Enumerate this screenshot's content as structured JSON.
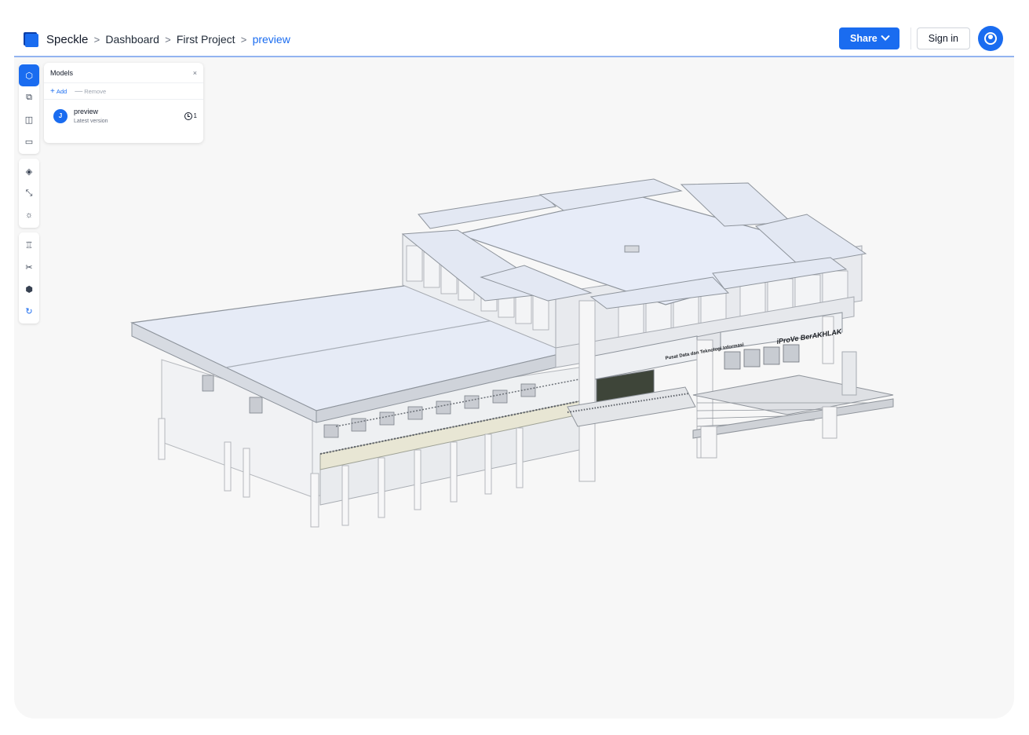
{
  "header": {
    "brand": "Speckle",
    "breadcrumbs": [
      "Dashboard",
      "First Project",
      "preview"
    ],
    "separator": ">",
    "share_label": "Share",
    "signin_label": "Sign in"
  },
  "toolbar": {
    "icons": [
      "models-cube-icon",
      "scene-tree-icon",
      "discussions-icon",
      "measure-ruler-icon",
      "views-camera-icon",
      "zoom-extents-icon",
      "light-sun-icon",
      "explode-icon",
      "section-scissors-icon",
      "filters-cubes-icon",
      "reset-spin-icon"
    ]
  },
  "models_panel": {
    "title": "Models",
    "close": "×",
    "add_label": "Add",
    "remove_label": "Remove",
    "models": [
      {
        "initial": "J",
        "name": "preview",
        "version_label": "Latest version",
        "version_count": "1"
      }
    ]
  },
  "building_signs": {
    "entrance_sign": "Pusat Data dan Teknologi Informasi",
    "banner": "iProVe BerAKHLAK"
  },
  "colors": {
    "accent": "#1a6cf0",
    "viewer_bg": "#f7f7f7"
  }
}
